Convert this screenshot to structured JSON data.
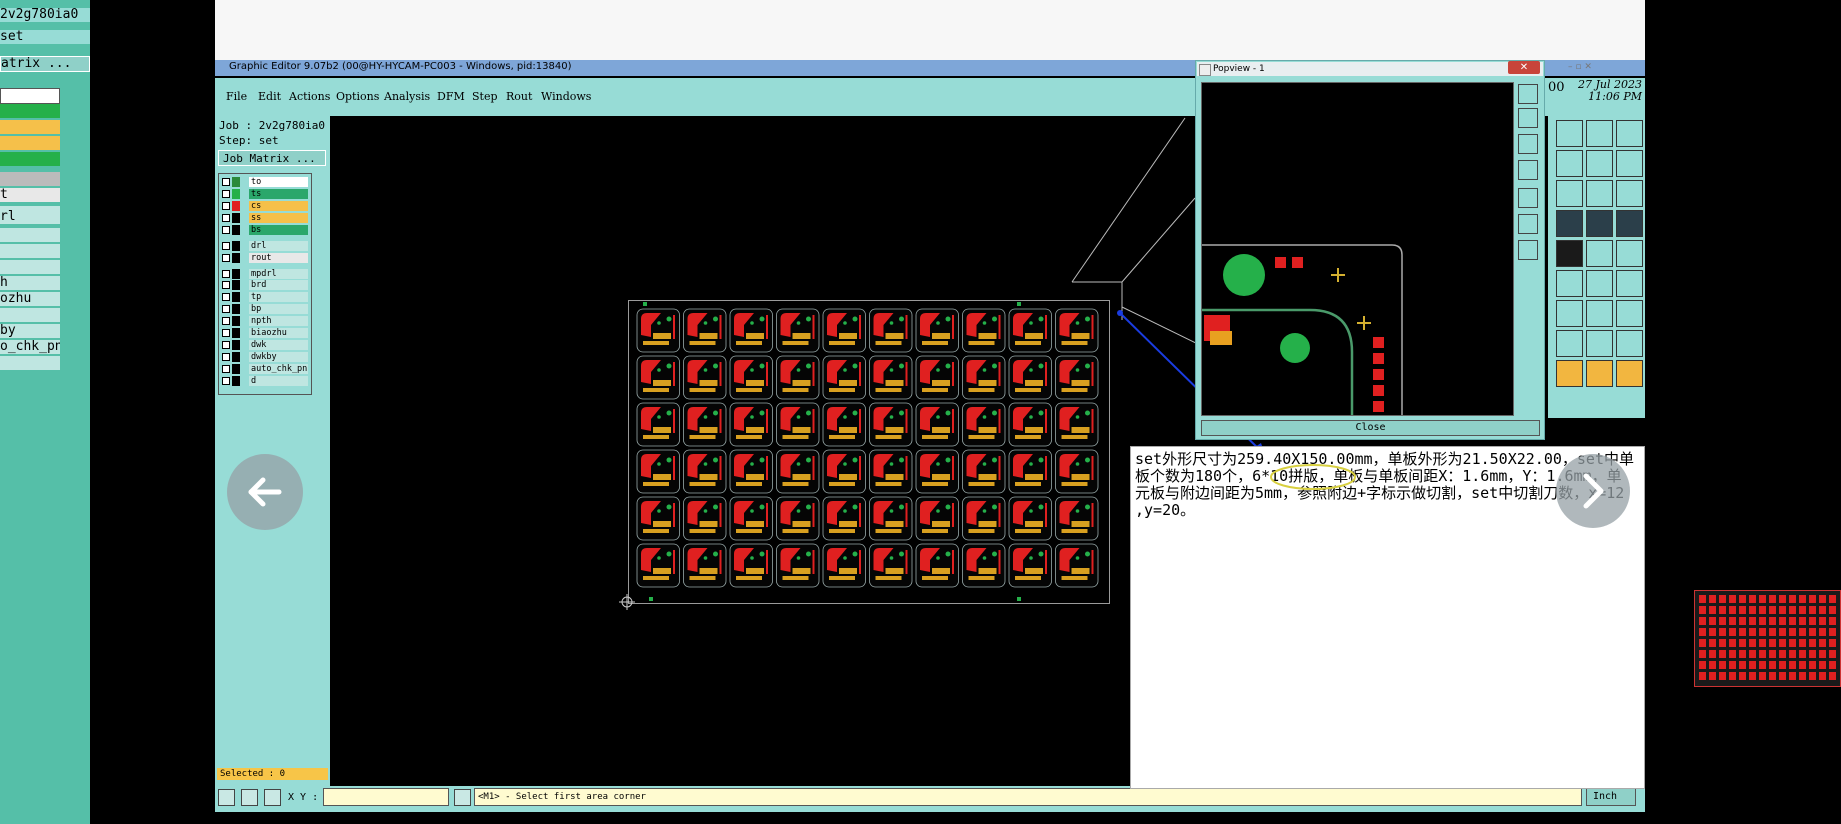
{
  "left_window": {
    "job_name": "2v2g780ia0",
    "step": "set",
    "job_matrix": "atrix ...",
    "items": [
      "t",
      "rl",
      "h",
      "ozhu",
      "by",
      "o_chk_pn"
    ]
  },
  "title_bar": {
    "text": "Graphic Editor 9.07b2 (00@HY-HYCAM-PC003 - Windows, pid:13840)"
  },
  "menu": [
    "File",
    "Edit",
    "Actions",
    "Options",
    "Analysis",
    "DFM",
    "Step",
    "Rout",
    "Windows"
  ],
  "job_panel": {
    "job_label": "Job : 2v2g780ia0",
    "step_label": "Step: set",
    "job_matrix_button": "Job Matrix ...",
    "layers": [
      {
        "name": "to",
        "color": "#ffffff",
        "swatch": "#2a8a3a"
      },
      {
        "name": "ts",
        "color": "#2aa76b",
        "swatch": "#25b04a"
      },
      {
        "name": "cs",
        "color": "#f5c04a",
        "swatch": "#e02020"
      },
      {
        "name": "ss",
        "color": "#f5c04a",
        "swatch": "#000000"
      },
      {
        "name": "bs",
        "color": "#2aa76b",
        "swatch": "#000000"
      },
      {
        "name": "drl",
        "color": "#bfe6e1",
        "swatch": "#000000"
      },
      {
        "name": "rout",
        "color": "#e8e8e8",
        "swatch": "#000000"
      },
      {
        "name": "mpdrl",
        "color": "#bfe6e1",
        "swatch": "#000000"
      },
      {
        "name": "brd",
        "color": "#bfe6e1",
        "swatch": "#000000"
      },
      {
        "name": "tp",
        "color": "#bfe6e1",
        "swatch": "#000000"
      },
      {
        "name": "bp",
        "color": "#bfe6e1",
        "swatch": "#000000"
      },
      {
        "name": "npth",
        "color": "#bfe6e1",
        "swatch": "#000000"
      },
      {
        "name": "biaozhu",
        "color": "#bfe6e1",
        "swatch": "#000000"
      },
      {
        "name": "dwk",
        "color": "#bfe6e1",
        "swatch": "#000000"
      },
      {
        "name": "dwkby",
        "color": "#bfe6e1",
        "swatch": "#000000"
      },
      {
        "name": "auto_chk_pn.",
        "color": "#bfe6e1",
        "swatch": "#000000"
      },
      {
        "name": "d",
        "color": "#bfe6e1",
        "swatch": "#000000"
      }
    ],
    "selected": "Selected : 0"
  },
  "status_bar": {
    "xy_label": "X Y :",
    "message": "<M1> - Select first area corner",
    "units": "Inch"
  },
  "popview": {
    "title": "Popview - 1",
    "close_button": "Close"
  },
  "date": {
    "day": "27 Jul 2023",
    "time": "11:06 PM",
    "partial": "00"
  },
  "note": {
    "text": "set外形尺寸为259.40X150.00mm，单板外形为21.50X22.00，set中单板个数为180个，6*10拼版，单板与单板间距X：1.6mm，Y：1.6mm，单元板与附边间距为5mm，参照附边+字标示做切割，set中切割刀数，x=12 ,y=20。"
  },
  "board": {
    "rows": 6,
    "cols": 10
  },
  "colors": {
    "teal": "#97dcd6",
    "pad_red": "#e02020",
    "pad_green": "#25b04a",
    "note_bg": "#ffffff"
  }
}
